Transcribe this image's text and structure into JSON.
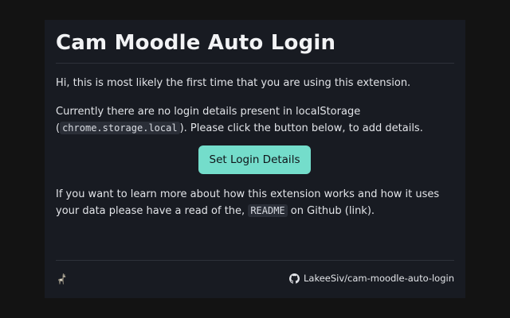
{
  "header": {
    "title": "Cam Moodle Auto Login"
  },
  "main": {
    "intro": "Hi, this is most likely the first time that you are using this extension.",
    "storage_text_before": "Currently there are no login details present in localStorage (",
    "storage_code": "chrome.storage.local",
    "storage_text_after": "). Please click the button below, to add details.",
    "button_label": "Set Login Details",
    "learn_text_before": "If you want to learn more about how this extension works and how it uses your data please have a read of the, ",
    "readme_code": "README",
    "learn_text_after": " on Github (link)."
  },
  "footer": {
    "logo_icon": "llama-icon",
    "github_icon": "github-icon",
    "repo_link": "LakeeSiv/cam-moodle-auto-login"
  },
  "colors": {
    "background": "#131313",
    "panel": "#181b22",
    "accent": "#74ddcb"
  }
}
